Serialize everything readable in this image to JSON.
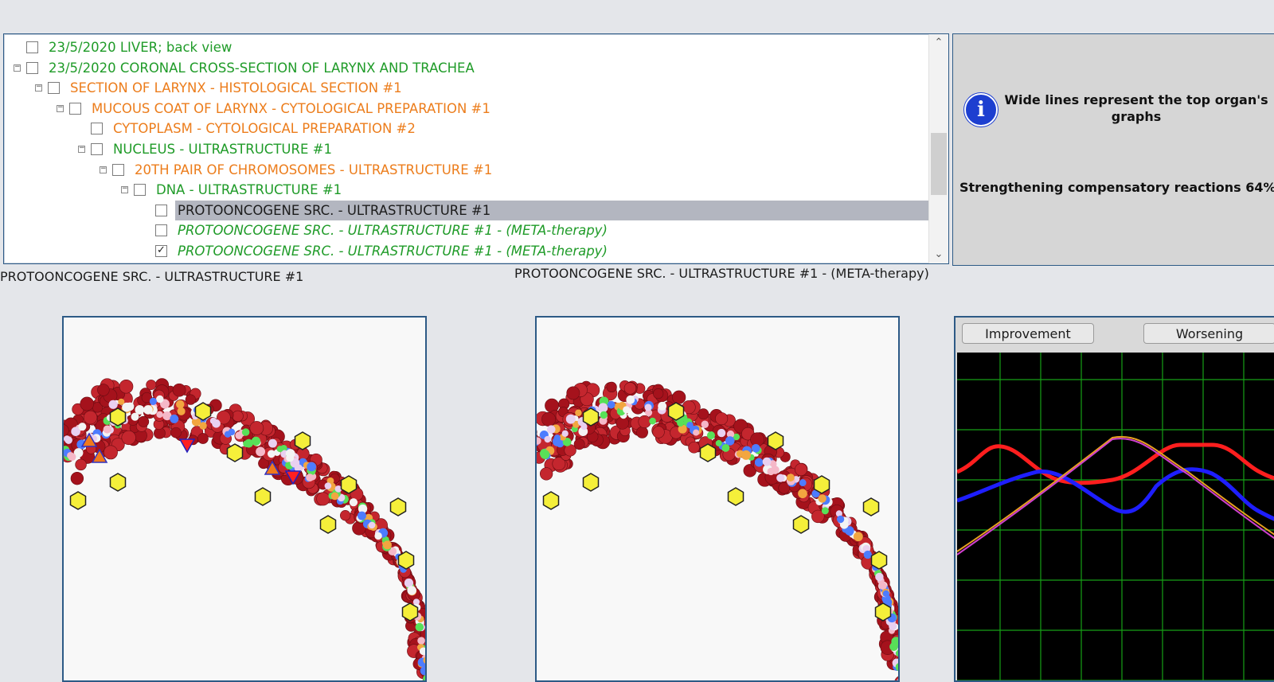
{
  "tree": {
    "rows": [
      {
        "label": "23/5/2020  LIVER; back view",
        "color": "green",
        "italic": false,
        "checked": false,
        "expander": false,
        "level": 0,
        "selected": false
      },
      {
        "label": "23/5/2020  CORONAL CROSS-SECTION OF LARYNX AND TRACHEA",
        "color": "green",
        "italic": false,
        "checked": false,
        "expander": true,
        "level": 0,
        "selected": false
      },
      {
        "label": "SECTION OF LARYNX - HISTOLOGICAL SECTION #1",
        "color": "orange",
        "italic": false,
        "checked": false,
        "expander": true,
        "level": 1,
        "selected": false
      },
      {
        "label": "MUCOUS COAT OF LARYNX - CYTOLOGICAL PREPARATION #1",
        "color": "orange",
        "italic": false,
        "checked": false,
        "expander": true,
        "level": 2,
        "selected": false
      },
      {
        "label": "CYTOPLASM - CYTOLOGICAL PREPARATION #2",
        "color": "orange",
        "italic": false,
        "checked": false,
        "expander": false,
        "level": 3,
        "selected": false
      },
      {
        "label": "NUCLEUS - ULTRASTRUCTURE #1",
        "color": "green",
        "italic": false,
        "checked": false,
        "expander": true,
        "level": 3,
        "selected": false
      },
      {
        "label": "20TH PAIR OF CHROMOSOMES - ULTRASTRUCTURE #1",
        "color": "orange",
        "italic": false,
        "checked": false,
        "expander": true,
        "level": 4,
        "selected": false
      },
      {
        "label": "DNA - ULTRASTRUCTURE #1",
        "color": "green",
        "italic": false,
        "checked": false,
        "expander": true,
        "level": 5,
        "selected": false
      },
      {
        "label": "PROTOONCOGENE SRC. - ULTRASTRUCTURE #1",
        "color": "dark",
        "italic": false,
        "checked": false,
        "expander": false,
        "level": 6,
        "selected": true
      },
      {
        "label": "PROTOONCOGENE SRC. - ULTRASTRUCTURE #1 - (META-therapy)",
        "color": "green",
        "italic": true,
        "checked": false,
        "expander": false,
        "level": 6,
        "selected": false
      },
      {
        "label": "PROTOONCOGENE SRC. - ULTRASTRUCTURE #1 - (META-therapy)",
        "color": "green",
        "italic": true,
        "checked": true,
        "expander": false,
        "level": 6,
        "selected": false
      }
    ],
    "check_mark": "✓",
    "scroll_up": "⌃",
    "scroll_down": "⌄"
  },
  "info": {
    "icon": "i",
    "message": "Wide lines represent the top organ's graphs",
    "status": "Strengthening compensatory reactions 64%"
  },
  "captions": {
    "left": "PROTOONCOGENE SRC. - ULTRASTRUCTURE #1",
    "right": "PROTOONCOGENE SRC. - ULTRASTRUCTURE #1 - (META-therapy)"
  },
  "graph": {
    "improvement_label": "Improvement",
    "worsening_label": "Worsening",
    "background": "#000000",
    "grid_color": "#16a016",
    "series_colors": [
      "#ff1e1e",
      "#1e1eff",
      "#e8a020",
      "#d040d0"
    ]
  },
  "colors": {
    "green": "#1f9b28",
    "orange": "#ec7d1c",
    "dark": "#1c1c1c"
  }
}
